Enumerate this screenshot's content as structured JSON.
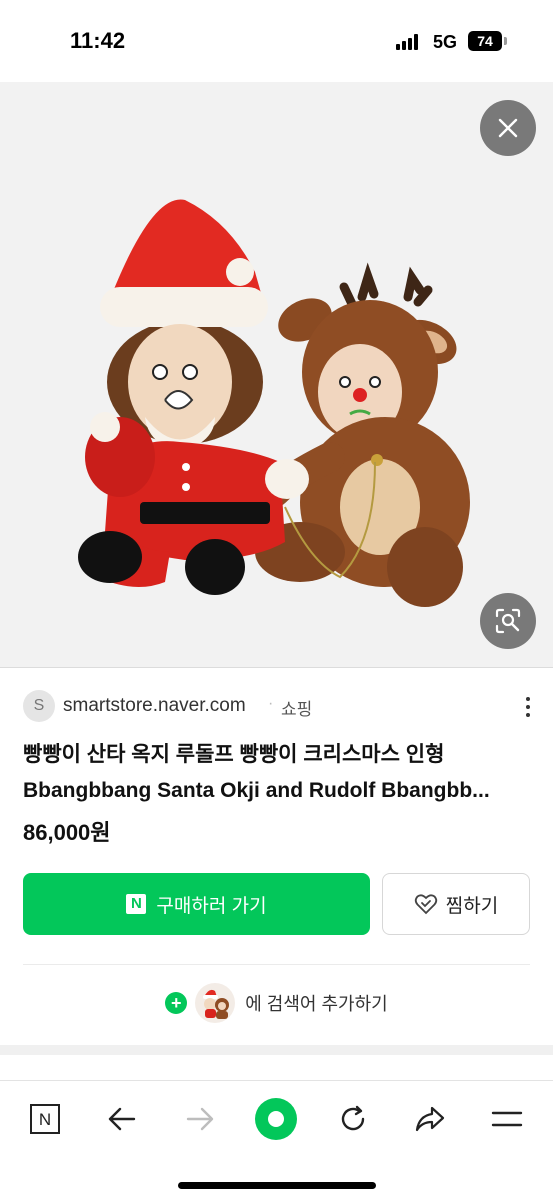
{
  "status_bar": {
    "time": "11:42",
    "network": "5G",
    "battery": "74"
  },
  "hero": {
    "close_icon": "close-icon",
    "lens_icon": "image-search-icon"
  },
  "result": {
    "source_initial": "S",
    "source_domain": "smartstore.naver.com",
    "source_separator": "·",
    "source_category": "쇼핑",
    "title": "빵빵이 산타 옥지 루돌프 빵빵이 크리스마스 인형 Bbangbbang Santa Okji and Rudolf Bbangbb...",
    "price": "86,000원",
    "buy_badge": "N",
    "buy_label": "구매하러 가기",
    "wish_label": "찜하기",
    "add_search_label": "에 검색어 추가하기"
  },
  "colors": {
    "naver_green": "#03c75a"
  },
  "toolbar": {
    "items": [
      "naver-n-icon",
      "back-arrow-icon",
      "forward-arrow-icon",
      "home-green-icon",
      "refresh-icon",
      "share-icon",
      "menu-icon"
    ],
    "n_label": "N"
  }
}
